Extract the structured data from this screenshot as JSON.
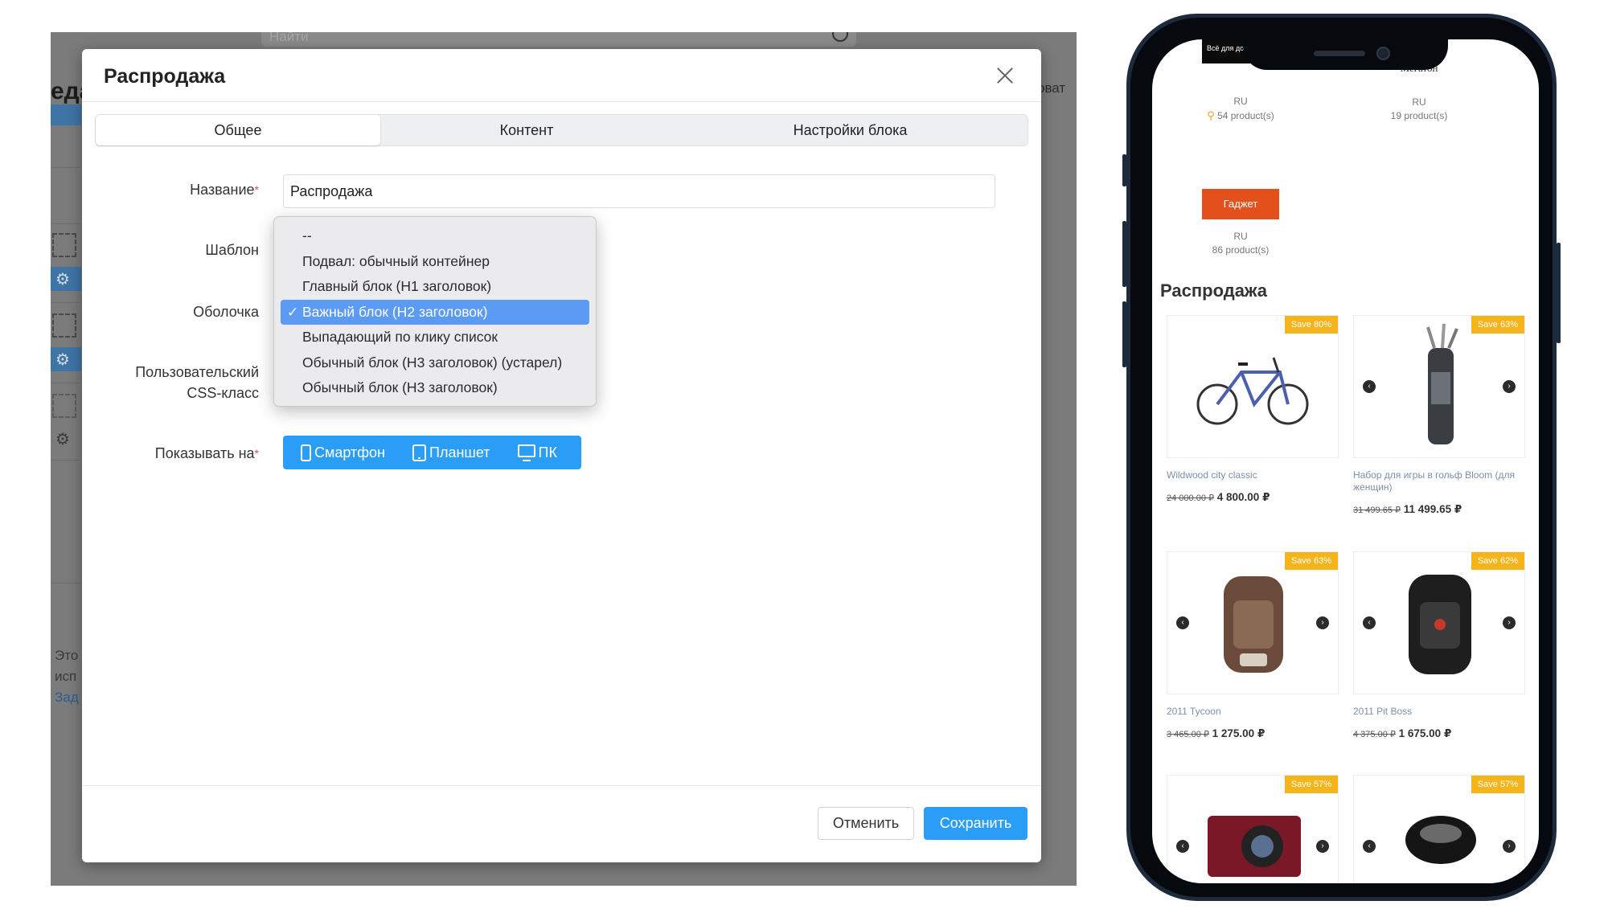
{
  "admin_bg": {
    "search_placeholder": "Найти",
    "left_heading_fragment": "еда",
    "right_fragment": "оват",
    "bottom_lines": [
      "Это",
      "исп",
      "Зад"
    ]
  },
  "modal": {
    "title": "Распродажа",
    "tabs": [
      "Общее",
      "Контент",
      "Настройки блока"
    ],
    "active_tab": "Общее",
    "fields": {
      "name_label": "Название",
      "name_value": "Распродажа",
      "template_label": "Шаблон",
      "wrapper_label": "Оболочка",
      "css_label_line1": "Пользовательский",
      "css_label_line2": "CSS-класс",
      "show_on_label": "Показывать на"
    },
    "dropdown": {
      "options": [
        "--",
        "Подвал: обычный контейнер",
        "Главный блок (H1 заголовок)",
        "Важный блок (H2 заголовок)",
        "Выпадающий по клику список",
        "Обычный блок (H3 заголовок) (устарел)",
        "Обычный блок (H3 заголовок)"
      ],
      "selected": "Важный блок (H2 заголовок)",
      "check_glyph": "✓"
    },
    "show_on": [
      "Смартфон",
      "Планшет",
      "ПК"
    ],
    "buttons": {
      "cancel": "Отменить",
      "save": "Сохранить"
    },
    "colors": {
      "primary": "#2a9ef6",
      "selected_option": "#5b9bf3",
      "required": "#e34b4b"
    }
  },
  "phone": {
    "brands": [
      {
        "logo_text": "Всё для дома",
        "lang": "RU",
        "count": "54 product(s)"
      },
      {
        "logo_text": "Мегатон",
        "lang": "RU",
        "count": "19 product(s)"
      },
      {
        "logo_text": "Гаджет",
        "lang": "RU",
        "count": "86 product(s)"
      }
    ],
    "section_title": "Распродажа",
    "products": [
      {
        "badge": "Save 80%",
        "name": "Wildwood city classic",
        "old_price": "24 000.00 ₽",
        "price": "4 800.00 ₽",
        "image": "bicycle"
      },
      {
        "badge": "Save 63%",
        "name": "Набор для игры в гольф Bloom (для женщин)",
        "old_price": "31 499.65 ₽",
        "price": "11 499.65 ₽",
        "image": "golf-bag"
      },
      {
        "badge": "Save 63%",
        "name": "2011 Tycoon",
        "old_price": "3 465.00 ₽",
        "price": "1 275.00 ₽",
        "image": "backpack-brown"
      },
      {
        "badge": "Save 62%",
        "name": "2011 Pit Boss",
        "old_price": "4 375.00 ₽",
        "price": "1 675.00 ₽",
        "image": "backpack-black"
      },
      {
        "badge": "Save 57%",
        "name": "",
        "old_price": "",
        "price": "",
        "image": "camera"
      },
      {
        "badge": "Save 57%",
        "name": "",
        "old_price": "",
        "price": "",
        "image": "golf-driver"
      }
    ],
    "colors": {
      "badge": "#f4b41a",
      "frame": "#1c2a3c"
    }
  }
}
